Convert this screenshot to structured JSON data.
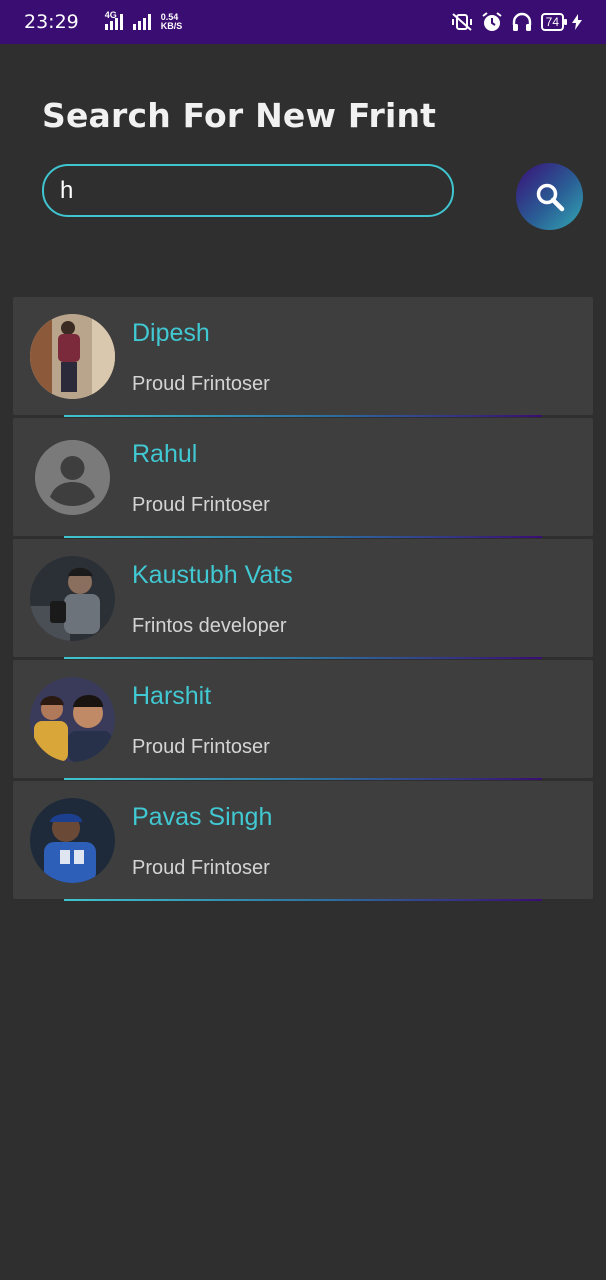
{
  "status_bar": {
    "time": "23:29",
    "network_type": "4G",
    "speed_value": "0.54",
    "speed_unit": "KB/S",
    "battery": "74"
  },
  "page": {
    "title": "Search For New Frint"
  },
  "search": {
    "value": "h",
    "button_icon": "search-icon"
  },
  "results": [
    {
      "name": "Dipesh",
      "status": "Proud Frintoser",
      "avatar": "photo"
    },
    {
      "name": "Rahul",
      "status": "Proud Frintoser",
      "avatar": "default-user-icon"
    },
    {
      "name": "Kaustubh Vats",
      "status": "Frintos developer",
      "avatar": "photo"
    },
    {
      "name": "Harshit",
      "status": "Proud Frintoser",
      "avatar": "photo"
    },
    {
      "name": "Pavas Singh",
      "status": "Proud Frintoser",
      "avatar": "photo"
    }
  ],
  "colors": {
    "background": "#2f2f2f",
    "card": "#3e3e3e",
    "accent": "#41c8d2",
    "status_bar": "#3a0d72"
  }
}
